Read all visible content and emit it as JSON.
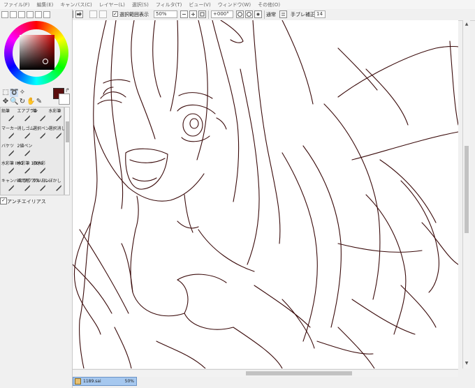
{
  "menu": [
    "ファイル(F)",
    "編集(E)",
    "キャンバス(C)",
    "レイヤー(L)",
    "選択(S)",
    "フィルタ(T)",
    "ビュー(V)",
    "ウィンドウ(W)",
    "その他(O)"
  ],
  "toolbar": {
    "selection_display_label": "選択範囲表示",
    "selection_display_checked": true,
    "zoom_value": "50%",
    "rotation_value": "+000°",
    "blend_mode_label": "通常",
    "stabilizer_label": "手ブレ補正",
    "stabilizer_value": "14"
  },
  "color_panel": {
    "current_color": "#5a0f0f",
    "secondary_color": "#ffffff"
  },
  "brushes": [
    {
      "label": "鉛筆"
    },
    {
      "label": "エアブラシ"
    },
    {
      "label": "筆"
    },
    {
      "label": "水彩筆"
    },
    {
      "label": "マーカー"
    },
    {
      "label": "消しゴム"
    },
    {
      "label": "選択ペン"
    },
    {
      "label": "選択消し"
    },
    {
      "label": "バケツ"
    },
    {
      "label": "2値ペン"
    },
    {
      "label": ""
    },
    {
      "label": ""
    },
    {
      "label": "水彩筆 IMG"
    },
    {
      "label": "水彩筆 100%"
    },
    {
      "label": "旧水彩"
    },
    {
      "label": ""
    },
    {
      "label": "キャンバス アクリル"
    },
    {
      "label": "画用紙 アクリル"
    },
    {
      "label": "クレヨン"
    },
    {
      "label": "ぼかし"
    }
  ],
  "antialias_label": "アンチエイリアス",
  "antialias_checked": true,
  "status": {
    "filename": "1189.sai",
    "zoom": "50%"
  },
  "colors": {
    "line": "#3a0a0a",
    "accent": "#a6c8ef"
  }
}
